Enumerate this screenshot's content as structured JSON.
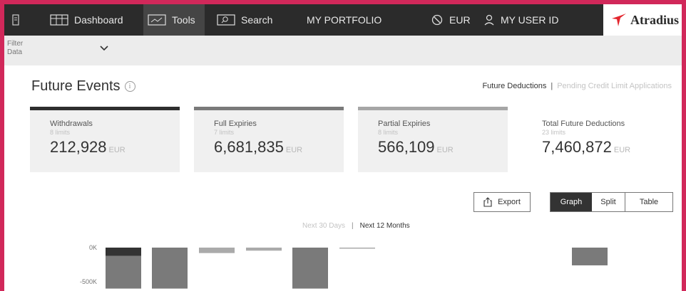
{
  "nav": {
    "items": [
      {
        "label": "Dashboard",
        "icon": "grid-icon"
      },
      {
        "label": "Tools",
        "icon": "chart-icon"
      },
      {
        "label": "Search",
        "icon": "search-icon"
      },
      {
        "label": "MY PORTFOLIO"
      }
    ],
    "currency": "EUR",
    "user": "MY USER ID",
    "brand": "Atradius"
  },
  "filter": {
    "label": "Filter Data"
  },
  "page": {
    "title": "Future Events"
  },
  "tabs": {
    "active": "Future Deductions",
    "separator": "|",
    "inactive": "Pending Credit Limit Applications"
  },
  "cards": [
    {
      "title": "Withdrawals",
      "sub": "8 limits",
      "value": "212,928",
      "currency": "EUR",
      "bar_color": "#2e2e2e"
    },
    {
      "title": "Full Expiries",
      "sub": "7 limits",
      "value": "6,681,835",
      "currency": "EUR",
      "bar_color": "#7a7a7a"
    },
    {
      "title": "Partial Expiries",
      "sub": "8 limits",
      "value": "566,109",
      "currency": "EUR",
      "bar_color": "#a6a6a6"
    },
    {
      "title": "Total Future Deductions",
      "sub": "23 limits",
      "value": "7,460,872",
      "currency": "EUR",
      "bar_color": ""
    }
  ],
  "actions": {
    "export": "Export",
    "views": [
      "Graph",
      "Split",
      "Table"
    ],
    "active_view": "Graph"
  },
  "period": {
    "options": [
      "Next 30 Days",
      "Next 12 Months"
    ],
    "separator": "|",
    "active": "Next 12 Months"
  },
  "chart_data": {
    "type": "bar",
    "ytick_labels": [
      "0K",
      "-500K"
    ],
    "ylim": [
      -600,
      0
    ],
    "colors": {
      "withdrawals": "#333333",
      "full": "#7a7a7a",
      "partial": "#aaaaaa"
    },
    "series": [
      {
        "values": [
          -120,
          0,
          0,
          0,
          0,
          0,
          0,
          0,
          0,
          0
        ]
      },
      {
        "values": [
          -480,
          -600,
          0,
          0,
          -600,
          0,
          0,
          0,
          0,
          -260
        ]
      },
      {
        "values": [
          0,
          0,
          -80,
          -45,
          0,
          -8,
          0,
          0,
          0,
          0
        ]
      }
    ]
  }
}
